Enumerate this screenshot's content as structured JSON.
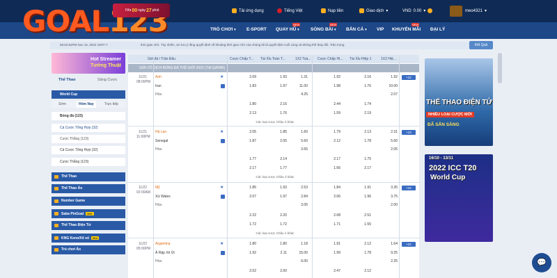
{
  "brand": {
    "logo_prefix": "GOAL",
    "logo_numbers": "123"
  },
  "banner": {
    "text_left": "Fifa",
    "days": "00",
    "label": "ngày",
    "minutes": "27",
    "unit": "phút"
  },
  "topbar": {
    "app": "Tải ứng dụng",
    "lang": "Tiếng Việt",
    "deposit": "Nạp tiền",
    "transactions": "Giao dịch",
    "currency": "VND",
    "balance": "0.00",
    "user": "meo4321"
  },
  "nav": {
    "items": [
      "TRÒ CHƠI",
      "E-SPORT",
      "QUAY HŨ",
      "SÒNG BÀI",
      "BẮN CÁ",
      "VIP",
      "KHUYẾN MÃI",
      "ĐẠI LÝ"
    ]
  },
  "ticker": {
    "time": "06:52:52PM Nov 15, 2022 GMT+7",
    "text": "thời gian chờ. Tùy nhiên, xin lưu ý rằng quyết định về khoảng thời gian chờ của chúng tôi là quyết định cuối cùng và không thể thay đổi. Trân trọng.",
    "result_button": "Kết Quả"
  },
  "promo": {
    "title": "Hot Streamer",
    "subtitle": "Tướng Thuật"
  },
  "left": {
    "tabs": [
      "Thể Thao",
      "Sảng Cược"
    ],
    "worldcup": "World Cup",
    "subtabs": [
      "Sớm",
      "Hôm Nay",
      "Trực tiếp"
    ],
    "rows": [
      "Bóng đá (123)",
      "Cá Cược Tổng Hợp (32)",
      "Cược Thắng (123)",
      "Cá Cược Tổng Hợp (32)",
      "Cược Thắng (123)"
    ],
    "blocks": [
      "Thể Thao",
      "Thể Thao Ảo",
      "Number Game",
      "Saba PinGoal",
      "Thể Thao Điện Tử",
      "KNG Keno/Xổ số",
      "Trò chơi Ảo"
    ],
    "moi": "Mới"
  },
  "table": {
    "headers": [
      "Giờ đá / Trận Đấu",
      "Cược Chấp T...",
      "Tài Xỉu Toàn T...",
      "1X2 Toà...",
      "Cược Chấp Hi...",
      "Tài Xỉu Hiệp 1",
      "1X2 Hiệ..."
    ],
    "league": "GIẢI VÔ ĐỊCH BÓNG ĐÁ THẾ GIỚI 2022 (TẠI QATAR)",
    "more_label": "Các loại cược Châu Á khác",
    "matches": [
      {
        "date": "11/21",
        "time": "08:00PM",
        "home": "Anh",
        "away": "Iran",
        "draw": "Hòa",
        "plus": "+22"
      },
      {
        "date": "11/21",
        "time": "11:00PM",
        "home": "Hà Lan",
        "away": "Senegal",
        "draw": "Hòa",
        "plus": "+23"
      },
      {
        "date": "11/22",
        "time": "02:00AM",
        "home": "Mỹ",
        "away": "Xứ Wales",
        "draw": "Hòa",
        "plus": "+24"
      },
      {
        "date": "11/22",
        "time": "05:00PM",
        "home": "Argentina",
        "away": "Ả Rập Xê Út",
        "draw": "Hòa",
        "plus": "+22"
      }
    ]
  },
  "right": {
    "banner1": {
      "title": "THỂ THAO ĐIỆN TỬ",
      "sub": "NHIỀU LOẠI CƯỢC MỚI",
      "ready": "ĐÃ SẴN SÀNG"
    },
    "banner2": {
      "dates": "16/10 - 13/11",
      "title": "2022 ICC T20",
      "sub": "World Cup"
    }
  }
}
